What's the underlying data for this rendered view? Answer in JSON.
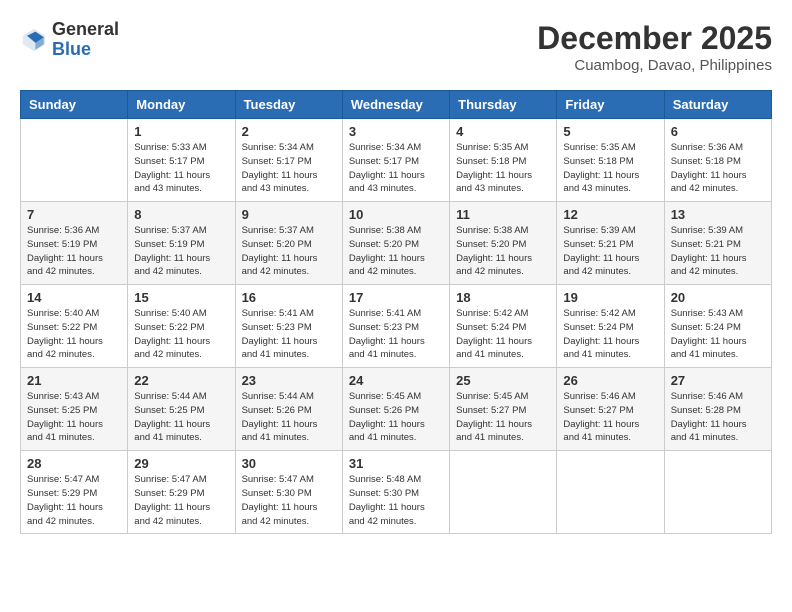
{
  "header": {
    "logo_general": "General",
    "logo_blue": "Blue",
    "month_title": "December 2025",
    "location": "Cuambog, Davao, Philippines"
  },
  "calendar": {
    "headers": [
      "Sunday",
      "Monday",
      "Tuesday",
      "Wednesday",
      "Thursday",
      "Friday",
      "Saturday"
    ],
    "weeks": [
      [
        {
          "day": "",
          "info": ""
        },
        {
          "day": "1",
          "info": "Sunrise: 5:33 AM\nSunset: 5:17 PM\nDaylight: 11 hours\nand 43 minutes."
        },
        {
          "day": "2",
          "info": "Sunrise: 5:34 AM\nSunset: 5:17 PM\nDaylight: 11 hours\nand 43 minutes."
        },
        {
          "day": "3",
          "info": "Sunrise: 5:34 AM\nSunset: 5:17 PM\nDaylight: 11 hours\nand 43 minutes."
        },
        {
          "day": "4",
          "info": "Sunrise: 5:35 AM\nSunset: 5:18 PM\nDaylight: 11 hours\nand 43 minutes."
        },
        {
          "day": "5",
          "info": "Sunrise: 5:35 AM\nSunset: 5:18 PM\nDaylight: 11 hours\nand 43 minutes."
        },
        {
          "day": "6",
          "info": "Sunrise: 5:36 AM\nSunset: 5:18 PM\nDaylight: 11 hours\nand 42 minutes."
        }
      ],
      [
        {
          "day": "7",
          "info": "Sunrise: 5:36 AM\nSunset: 5:19 PM\nDaylight: 11 hours\nand 42 minutes."
        },
        {
          "day": "8",
          "info": "Sunrise: 5:37 AM\nSunset: 5:19 PM\nDaylight: 11 hours\nand 42 minutes."
        },
        {
          "day": "9",
          "info": "Sunrise: 5:37 AM\nSunset: 5:20 PM\nDaylight: 11 hours\nand 42 minutes."
        },
        {
          "day": "10",
          "info": "Sunrise: 5:38 AM\nSunset: 5:20 PM\nDaylight: 11 hours\nand 42 minutes."
        },
        {
          "day": "11",
          "info": "Sunrise: 5:38 AM\nSunset: 5:20 PM\nDaylight: 11 hours\nand 42 minutes."
        },
        {
          "day": "12",
          "info": "Sunrise: 5:39 AM\nSunset: 5:21 PM\nDaylight: 11 hours\nand 42 minutes."
        },
        {
          "day": "13",
          "info": "Sunrise: 5:39 AM\nSunset: 5:21 PM\nDaylight: 11 hours\nand 42 minutes."
        }
      ],
      [
        {
          "day": "14",
          "info": "Sunrise: 5:40 AM\nSunset: 5:22 PM\nDaylight: 11 hours\nand 42 minutes."
        },
        {
          "day": "15",
          "info": "Sunrise: 5:40 AM\nSunset: 5:22 PM\nDaylight: 11 hours\nand 42 minutes."
        },
        {
          "day": "16",
          "info": "Sunrise: 5:41 AM\nSunset: 5:23 PM\nDaylight: 11 hours\nand 41 minutes."
        },
        {
          "day": "17",
          "info": "Sunrise: 5:41 AM\nSunset: 5:23 PM\nDaylight: 11 hours\nand 41 minutes."
        },
        {
          "day": "18",
          "info": "Sunrise: 5:42 AM\nSunset: 5:24 PM\nDaylight: 11 hours\nand 41 minutes."
        },
        {
          "day": "19",
          "info": "Sunrise: 5:42 AM\nSunset: 5:24 PM\nDaylight: 11 hours\nand 41 minutes."
        },
        {
          "day": "20",
          "info": "Sunrise: 5:43 AM\nSunset: 5:24 PM\nDaylight: 11 hours\nand 41 minutes."
        }
      ],
      [
        {
          "day": "21",
          "info": "Sunrise: 5:43 AM\nSunset: 5:25 PM\nDaylight: 11 hours\nand 41 minutes."
        },
        {
          "day": "22",
          "info": "Sunrise: 5:44 AM\nSunset: 5:25 PM\nDaylight: 11 hours\nand 41 minutes."
        },
        {
          "day": "23",
          "info": "Sunrise: 5:44 AM\nSunset: 5:26 PM\nDaylight: 11 hours\nand 41 minutes."
        },
        {
          "day": "24",
          "info": "Sunrise: 5:45 AM\nSunset: 5:26 PM\nDaylight: 11 hours\nand 41 minutes."
        },
        {
          "day": "25",
          "info": "Sunrise: 5:45 AM\nSunset: 5:27 PM\nDaylight: 11 hours\nand 41 minutes."
        },
        {
          "day": "26",
          "info": "Sunrise: 5:46 AM\nSunset: 5:27 PM\nDaylight: 11 hours\nand 41 minutes."
        },
        {
          "day": "27",
          "info": "Sunrise: 5:46 AM\nSunset: 5:28 PM\nDaylight: 11 hours\nand 41 minutes."
        }
      ],
      [
        {
          "day": "28",
          "info": "Sunrise: 5:47 AM\nSunset: 5:29 PM\nDaylight: 11 hours\nand 42 minutes."
        },
        {
          "day": "29",
          "info": "Sunrise: 5:47 AM\nSunset: 5:29 PM\nDaylight: 11 hours\nand 42 minutes."
        },
        {
          "day": "30",
          "info": "Sunrise: 5:47 AM\nSunset: 5:30 PM\nDaylight: 11 hours\nand 42 minutes."
        },
        {
          "day": "31",
          "info": "Sunrise: 5:48 AM\nSunset: 5:30 PM\nDaylight: 11 hours\nand 42 minutes."
        },
        {
          "day": "",
          "info": ""
        },
        {
          "day": "",
          "info": ""
        },
        {
          "day": "",
          "info": ""
        }
      ]
    ]
  }
}
